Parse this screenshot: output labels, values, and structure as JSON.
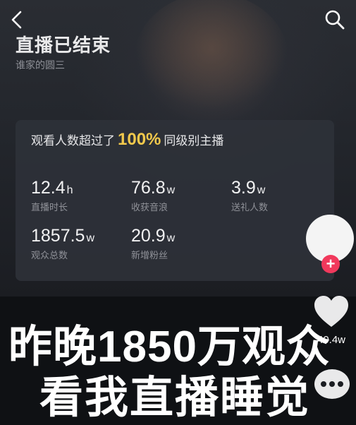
{
  "header": {
    "title": "直播已结束",
    "host_name": "谁家的圆三"
  },
  "stats_card": {
    "headline_prefix": "观看人数超过了",
    "headline_percent": "100%",
    "headline_suffix": "同级别主播",
    "stats": [
      {
        "value": "12.4",
        "unit": "h",
        "label": "直播时长"
      },
      {
        "value": "76.8",
        "unit": "w",
        "label": "收获音浪"
      },
      {
        "value": "3.9",
        "unit": "w",
        "label": "送礼人数"
      },
      {
        "value": "1857.5",
        "unit": "w",
        "label": "观众总数"
      },
      {
        "value": "20.9",
        "unit": "w",
        "label": "新增粉丝"
      }
    ]
  },
  "side_actions": {
    "follow_symbol": "+",
    "like_count": "40.4w"
  },
  "caption": {
    "line1": "昨晚1850万观众",
    "line2": "看我直播睡觉"
  },
  "colors": {
    "highlight": "#f2c94c",
    "follow_red": "#f1395c"
  }
}
